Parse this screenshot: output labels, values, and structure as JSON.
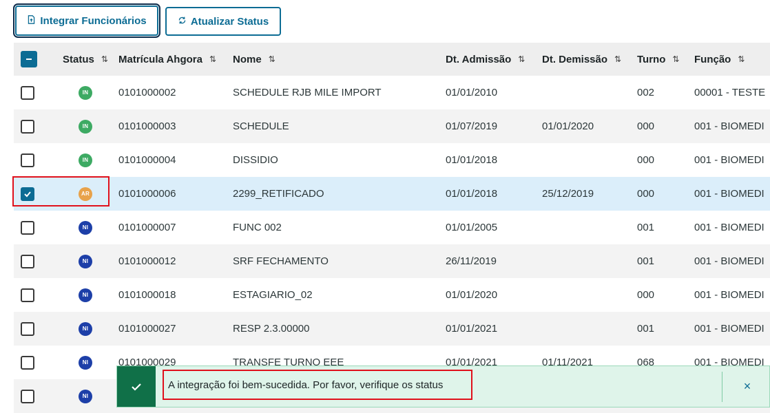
{
  "toolbar": {
    "integrate_label": "Integrar Funcionários",
    "refresh_label": "Atualizar Status"
  },
  "table": {
    "columns": {
      "status": "Status",
      "matricula": "Matrícula Ahgora",
      "nome": "Nome",
      "admissao": "Dt. Admissão",
      "demissao": "Dt. Demissão",
      "turno": "Turno",
      "funcao": "Função"
    },
    "sort_glyph": "⇅",
    "rows": [
      {
        "status": "IN",
        "matricula": "0101000002",
        "nome": "SCHEDULE RJB MILE IMPORT",
        "admissao": "01/01/2010",
        "demissao": "",
        "turno": "002",
        "funcao": "00001 - TESTE",
        "checked": false
      },
      {
        "status": "IN",
        "matricula": "0101000003",
        "nome": "SCHEDULE",
        "admissao": "01/07/2019",
        "demissao": "01/01/2020",
        "turno": "000",
        "funcao": "001 - BIOMEDI",
        "checked": false
      },
      {
        "status": "IN",
        "matricula": "0101000004",
        "nome": "DISSIDIO",
        "admissao": "01/01/2018",
        "demissao": "",
        "turno": "000",
        "funcao": "001 - BIOMEDI",
        "checked": false
      },
      {
        "status": "AR",
        "matricula": "0101000006",
        "nome": "2299_RETIFICADO",
        "admissao": "01/01/2018",
        "demissao": "25/12/2019",
        "turno": "000",
        "funcao": "001 - BIOMEDI",
        "checked": true
      },
      {
        "status": "NI",
        "matricula": "0101000007",
        "nome": "FUNC 002",
        "admissao": "01/01/2005",
        "demissao": "",
        "turno": "001",
        "funcao": "001 - BIOMEDI",
        "checked": false
      },
      {
        "status": "NI",
        "matricula": "0101000012",
        "nome": "SRF FECHAMENTO",
        "admissao": "26/11/2019",
        "demissao": "",
        "turno": "001",
        "funcao": "001 - BIOMEDI",
        "checked": false
      },
      {
        "status": "NI",
        "matricula": "0101000018",
        "nome": "ESTAGIARIO_02",
        "admissao": "01/01/2020",
        "demissao": "",
        "turno": "000",
        "funcao": "001 - BIOMEDI",
        "checked": false
      },
      {
        "status": "NI",
        "matricula": "0101000027",
        "nome": "RESP 2.3.00000",
        "admissao": "01/01/2021",
        "demissao": "",
        "turno": "001",
        "funcao": "001 - BIOMEDI",
        "checked": false
      },
      {
        "status": "NI",
        "matricula": "0101000029",
        "nome": "TRANSFE TURNO EEE",
        "admissao": "01/01/2021",
        "demissao": "01/11/2021",
        "turno": "068",
        "funcao": "001 - BIOMEDI",
        "checked": false
      },
      {
        "status": "NI",
        "matricula": "",
        "nome": "",
        "admissao": "",
        "demissao": "",
        "turno": "",
        "funcao": "",
        "checked": false
      }
    ]
  },
  "status_colors": {
    "IN": "#3daa63",
    "AR": "#e8a24a",
    "NI": "#1d3fa8"
  },
  "toast": {
    "message": "A integração foi bem-sucedida. Por favor, verifique os status",
    "close_glyph": "×",
    "icon": "check-icon"
  }
}
